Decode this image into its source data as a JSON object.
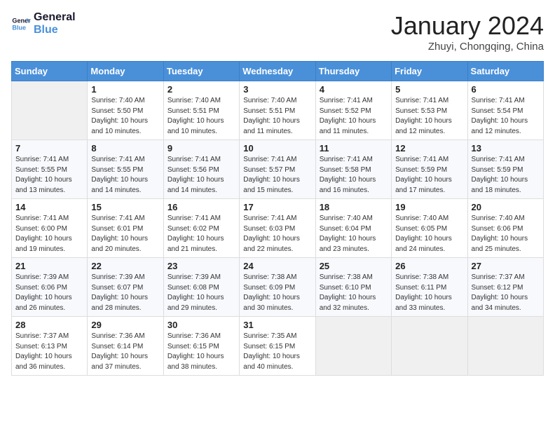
{
  "header": {
    "logo_line1": "General",
    "logo_line2": "Blue",
    "month": "January 2024",
    "location": "Zhuyi, Chongqing, China"
  },
  "weekdays": [
    "Sunday",
    "Monday",
    "Tuesday",
    "Wednesday",
    "Thursday",
    "Friday",
    "Saturday"
  ],
  "weeks": [
    [
      {
        "num": "",
        "info": ""
      },
      {
        "num": "1",
        "info": "Sunrise: 7:40 AM\nSunset: 5:50 PM\nDaylight: 10 hours\nand 10 minutes."
      },
      {
        "num": "2",
        "info": "Sunrise: 7:40 AM\nSunset: 5:51 PM\nDaylight: 10 hours\nand 10 minutes."
      },
      {
        "num": "3",
        "info": "Sunrise: 7:40 AM\nSunset: 5:51 PM\nDaylight: 10 hours\nand 11 minutes."
      },
      {
        "num": "4",
        "info": "Sunrise: 7:41 AM\nSunset: 5:52 PM\nDaylight: 10 hours\nand 11 minutes."
      },
      {
        "num": "5",
        "info": "Sunrise: 7:41 AM\nSunset: 5:53 PM\nDaylight: 10 hours\nand 12 minutes."
      },
      {
        "num": "6",
        "info": "Sunrise: 7:41 AM\nSunset: 5:54 PM\nDaylight: 10 hours\nand 12 minutes."
      }
    ],
    [
      {
        "num": "7",
        "info": "Sunrise: 7:41 AM\nSunset: 5:55 PM\nDaylight: 10 hours\nand 13 minutes."
      },
      {
        "num": "8",
        "info": "Sunrise: 7:41 AM\nSunset: 5:55 PM\nDaylight: 10 hours\nand 14 minutes."
      },
      {
        "num": "9",
        "info": "Sunrise: 7:41 AM\nSunset: 5:56 PM\nDaylight: 10 hours\nand 14 minutes."
      },
      {
        "num": "10",
        "info": "Sunrise: 7:41 AM\nSunset: 5:57 PM\nDaylight: 10 hours\nand 15 minutes."
      },
      {
        "num": "11",
        "info": "Sunrise: 7:41 AM\nSunset: 5:58 PM\nDaylight: 10 hours\nand 16 minutes."
      },
      {
        "num": "12",
        "info": "Sunrise: 7:41 AM\nSunset: 5:59 PM\nDaylight: 10 hours\nand 17 minutes."
      },
      {
        "num": "13",
        "info": "Sunrise: 7:41 AM\nSunset: 5:59 PM\nDaylight: 10 hours\nand 18 minutes."
      }
    ],
    [
      {
        "num": "14",
        "info": "Sunrise: 7:41 AM\nSunset: 6:00 PM\nDaylight: 10 hours\nand 19 minutes."
      },
      {
        "num": "15",
        "info": "Sunrise: 7:41 AM\nSunset: 6:01 PM\nDaylight: 10 hours\nand 20 minutes."
      },
      {
        "num": "16",
        "info": "Sunrise: 7:41 AM\nSunset: 6:02 PM\nDaylight: 10 hours\nand 21 minutes."
      },
      {
        "num": "17",
        "info": "Sunrise: 7:41 AM\nSunset: 6:03 PM\nDaylight: 10 hours\nand 22 minutes."
      },
      {
        "num": "18",
        "info": "Sunrise: 7:40 AM\nSunset: 6:04 PM\nDaylight: 10 hours\nand 23 minutes."
      },
      {
        "num": "19",
        "info": "Sunrise: 7:40 AM\nSunset: 6:05 PM\nDaylight: 10 hours\nand 24 minutes."
      },
      {
        "num": "20",
        "info": "Sunrise: 7:40 AM\nSunset: 6:06 PM\nDaylight: 10 hours\nand 25 minutes."
      }
    ],
    [
      {
        "num": "21",
        "info": "Sunrise: 7:39 AM\nSunset: 6:06 PM\nDaylight: 10 hours\nand 26 minutes."
      },
      {
        "num": "22",
        "info": "Sunrise: 7:39 AM\nSunset: 6:07 PM\nDaylight: 10 hours\nand 28 minutes."
      },
      {
        "num": "23",
        "info": "Sunrise: 7:39 AM\nSunset: 6:08 PM\nDaylight: 10 hours\nand 29 minutes."
      },
      {
        "num": "24",
        "info": "Sunrise: 7:38 AM\nSunset: 6:09 PM\nDaylight: 10 hours\nand 30 minutes."
      },
      {
        "num": "25",
        "info": "Sunrise: 7:38 AM\nSunset: 6:10 PM\nDaylight: 10 hours\nand 32 minutes."
      },
      {
        "num": "26",
        "info": "Sunrise: 7:38 AM\nSunset: 6:11 PM\nDaylight: 10 hours\nand 33 minutes."
      },
      {
        "num": "27",
        "info": "Sunrise: 7:37 AM\nSunset: 6:12 PM\nDaylight: 10 hours\nand 34 minutes."
      }
    ],
    [
      {
        "num": "28",
        "info": "Sunrise: 7:37 AM\nSunset: 6:13 PM\nDaylight: 10 hours\nand 36 minutes."
      },
      {
        "num": "29",
        "info": "Sunrise: 7:36 AM\nSunset: 6:14 PM\nDaylight: 10 hours\nand 37 minutes."
      },
      {
        "num": "30",
        "info": "Sunrise: 7:36 AM\nSunset: 6:15 PM\nDaylight: 10 hours\nand 38 minutes."
      },
      {
        "num": "31",
        "info": "Sunrise: 7:35 AM\nSunset: 6:15 PM\nDaylight: 10 hours\nand 40 minutes."
      },
      {
        "num": "",
        "info": ""
      },
      {
        "num": "",
        "info": ""
      },
      {
        "num": "",
        "info": ""
      }
    ]
  ]
}
